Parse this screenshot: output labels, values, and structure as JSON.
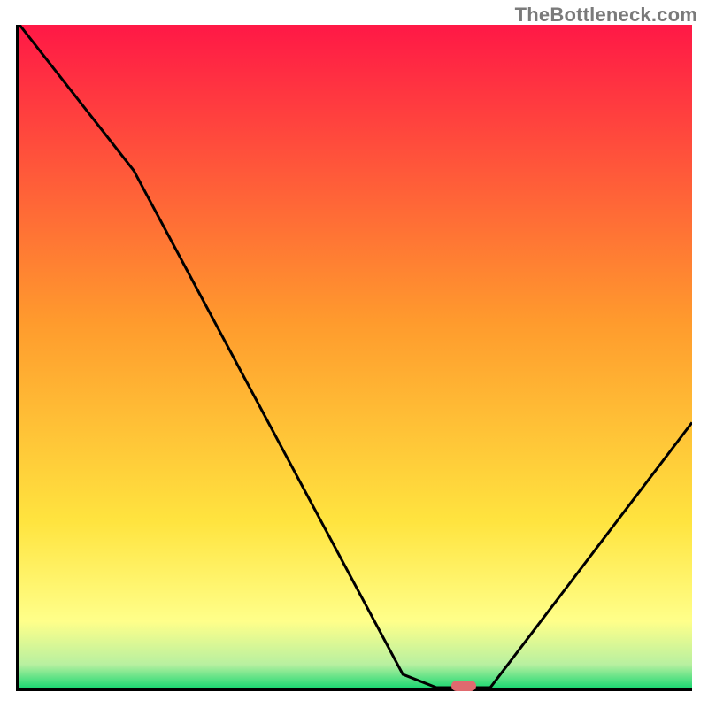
{
  "watermark": "TheBottleneck.com",
  "chart_data": {
    "type": "line",
    "title": "",
    "xlabel": "",
    "ylabel": "",
    "xlim": [
      0,
      100
    ],
    "ylim": [
      0,
      100
    ],
    "background_gradient": {
      "stops": [
        {
          "offset": 0.0,
          "color": "#ff1846"
        },
        {
          "offset": 0.45,
          "color": "#ff9b2d"
        },
        {
          "offset": 0.75,
          "color": "#ffe43f"
        },
        {
          "offset": 0.9,
          "color": "#ffff8a"
        },
        {
          "offset": 0.965,
          "color": "#b8f0a0"
        },
        {
          "offset": 1.0,
          "color": "#1fd873"
        }
      ]
    },
    "series": [
      {
        "name": "bottleneck-curve",
        "color": "#000000",
        "x": [
          0,
          17,
          57,
          62,
          70,
          100
        ],
        "y": [
          100,
          78,
          2,
          0,
          0,
          40
        ]
      }
    ],
    "marker": {
      "name": "optimal-point",
      "x": 66,
      "y": 0,
      "color": "#e06a6f"
    }
  }
}
